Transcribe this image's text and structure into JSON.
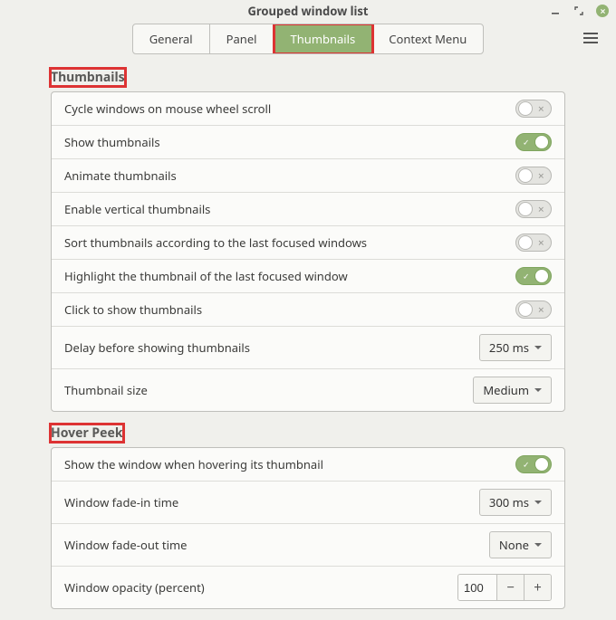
{
  "window": {
    "title": "Grouped window list"
  },
  "tabs": {
    "items": [
      {
        "label": "General"
      },
      {
        "label": "Panel"
      },
      {
        "label": "Thumbnails"
      },
      {
        "label": "Context Menu"
      }
    ],
    "active_index": 2
  },
  "sections": {
    "thumbnails": {
      "title": "Thumbnails",
      "rows": {
        "cycle": "Cycle windows on mouse wheel scroll",
        "show": "Show thumbnails",
        "animate": "Animate thumbnails",
        "vertical": "Enable vertical thumbnails",
        "sort": "Sort thumbnails according to the last focused windows",
        "highlight": "Highlight the thumbnail of the last focused window",
        "click": "Click to show thumbnails",
        "delay": "Delay before showing thumbnails",
        "size": "Thumbnail size"
      },
      "values": {
        "cycle": false,
        "show": true,
        "animate": false,
        "vertical": false,
        "sort": false,
        "highlight": true,
        "click": false,
        "delay": "250 ms",
        "size": "Medium"
      }
    },
    "hover_peek": {
      "title": "Hover Peek",
      "rows": {
        "show": "Show the window when hovering its thumbnail",
        "fadein": "Window fade-in time",
        "fadeout": "Window fade-out time",
        "opacity": "Window opacity (percent)"
      },
      "values": {
        "show": true,
        "fadein": "300 ms",
        "fadeout": "None",
        "opacity": "100"
      }
    }
  },
  "toggle_marks": {
    "on": "✓",
    "off": "✕"
  }
}
